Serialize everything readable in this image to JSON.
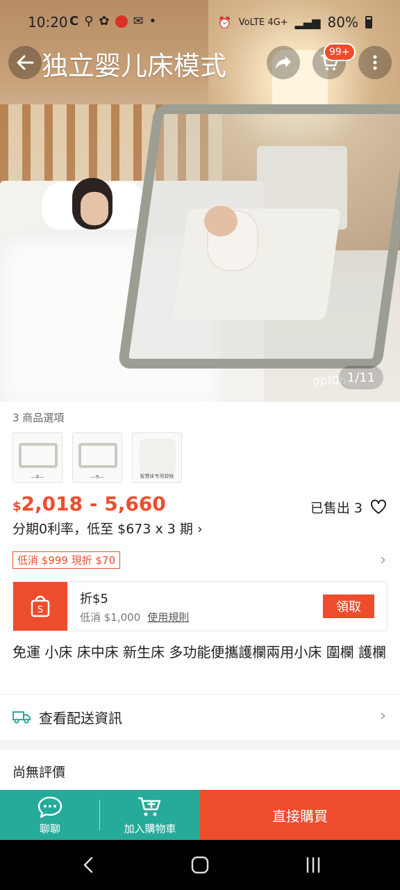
{
  "status_bar": {
    "time": "10:20",
    "left_icons": [
      "carrier-c-icon",
      "location-pin-icon",
      "clover-icon",
      "red-app-icon",
      "mail-icon",
      "dot-icon"
    ],
    "right_text_network": "VoLTE 4G+",
    "battery": "80%"
  },
  "hero": {
    "title": "独立婴儿床模式",
    "cart_badge": "99+",
    "pager": "1/11",
    "watermark": "gpf0h..."
  },
  "options": {
    "label": "3 商品選項",
    "thumbnails": [
      {
        "caption": "—8—"
      },
      {
        "caption": "—9—"
      },
      {
        "caption": "智慧床专用蚊帐"
      }
    ]
  },
  "price": {
    "currency": "$",
    "range": "2,018 - 5,660",
    "sold": "已售出 3",
    "installment": "分期0利率，低至 $673 x 3 期 ›"
  },
  "promo": {
    "tag": "低消 $999 現折 $70",
    "chevron": "›"
  },
  "voucher": {
    "title": "折$5",
    "min_spend": "低消 $1,000",
    "rule_link": "使用規則",
    "claim_label": "領取"
  },
  "product": {
    "title": "免運 小床 床中床 新生床 多功能便攜護欄兩用小床 圍欄 護欄"
  },
  "delivery": {
    "label": "查看配送資訊",
    "chevron": "›"
  },
  "reviews": {
    "label": "尚無評價"
  },
  "action_bar": {
    "chat_label": "聊聊",
    "add_cart_label": "加入購物車",
    "buy_label": "直接購買"
  },
  "colors": {
    "accent": "#ee4d2d",
    "teal": "#26aa99"
  }
}
